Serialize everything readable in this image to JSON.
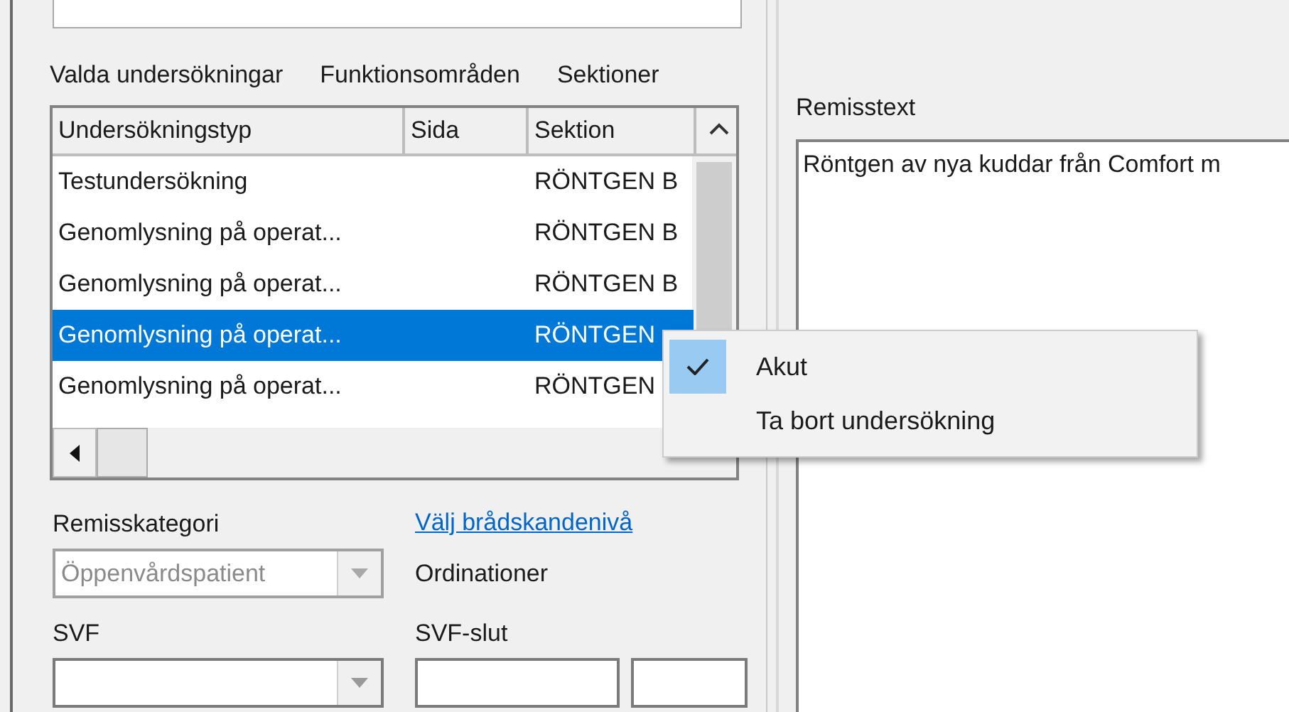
{
  "tabs": [
    {
      "label": "Valda undersökningar"
    },
    {
      "label": "Funktionsområden"
    },
    {
      "label": "Sektioner"
    }
  ],
  "exam_list": {
    "columns": [
      "Undersökningstyp",
      "Sida",
      "Sektion"
    ],
    "rows": [
      {
        "type": "Testundersökning",
        "section": "RÖNTGEN B",
        "selected": false
      },
      {
        "type": "Genomlysning på operat...",
        "section": "RÖNTGEN B",
        "selected": false
      },
      {
        "type": "Genomlysning på operat...",
        "section": "RÖNTGEN B",
        "selected": false
      },
      {
        "type": "Genomlysning på operat...",
        "section": "RÖNTGEN",
        "selected": true
      },
      {
        "type": "Genomlysning på operat...",
        "section": "RÖNTGEN",
        "selected": false
      }
    ]
  },
  "context_menu": {
    "items": [
      {
        "label": "Akut",
        "checked": true
      },
      {
        "label": "Ta bort undersökning",
        "checked": false
      }
    ]
  },
  "remisskategori": {
    "label": "Remisskategori",
    "value": "Öppenvårdspatient",
    "disabled": true
  },
  "urgency_link": "Välj brådskandenivå",
  "ordinationer_label": "Ordinationer",
  "svf": {
    "label": "SVF"
  },
  "svf_slut": {
    "label": "SVF-slut"
  },
  "remisstext": {
    "label": "Remisstext",
    "value": "Röntgen av nya kuddar från Comfort m"
  }
}
